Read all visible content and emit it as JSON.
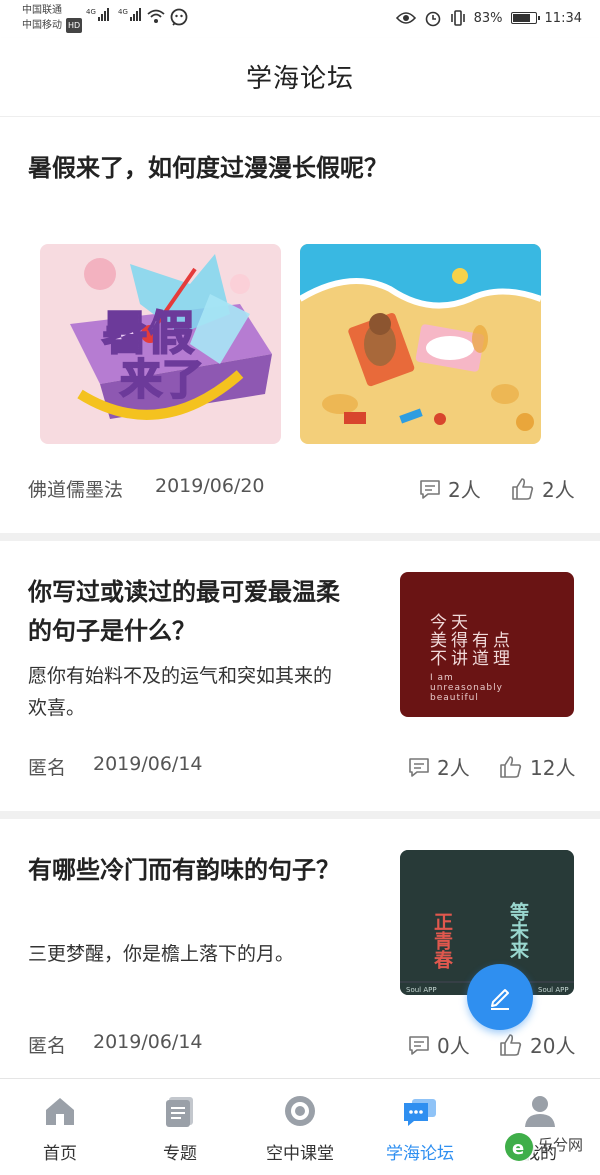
{
  "status_bar": {
    "carrier1": "中国联通",
    "carrier2": "中国移动",
    "hd": "HD",
    "net1": "4G",
    "net2": "4G",
    "battery_percent": "83%",
    "battery_level": 0.83,
    "time": "11:34"
  },
  "header": {
    "title": "学海论坛"
  },
  "posts": [
    {
      "title": "暑假来了，如何度过漫漫长假呢？",
      "image1_text_a": "暑假",
      "image1_text_b": "来了",
      "author": "佛道儒墨法",
      "date": "2019/06/20",
      "comments": "2人",
      "likes": "2人"
    },
    {
      "title_line1": "你写过或读过的最可爱最温柔",
      "title_line2": "的句子是什么？",
      "excerpt_line1": "愿你有始料不及的运气和突如其来的",
      "excerpt_line2": "欢喜。",
      "thumb_line1": "今天",
      "thumb_line2": "美得有点",
      "thumb_line3": "不讲道理",
      "thumb_en1": "I am",
      "thumb_en2": "unreasonably",
      "thumb_en3": "beautiful",
      "author": "匿名",
      "date": "2019/06/14",
      "comments": "2人",
      "likes": "12人"
    },
    {
      "title": "有哪些冷门而有韵味的句子？",
      "excerpt": "三更梦醒，你是檐上落下的月。",
      "thumb_left": "正青春",
      "thumb_right": "等未来",
      "thumb_footer_left": "Soul APP",
      "thumb_footer_right": "Soul APP",
      "author": "匿名",
      "date": "2019/06/14",
      "comments": "0人",
      "likes": "20人"
    }
  ],
  "tabs": [
    {
      "label": "首页",
      "icon": "home-icon"
    },
    {
      "label": "专题",
      "icon": "topics-icon"
    },
    {
      "label": "空中课堂",
      "icon": "disc-icon"
    },
    {
      "label": "学海论坛",
      "icon": "chat-icon"
    },
    {
      "label": "我的",
      "icon": "user-icon"
    }
  ],
  "watermark": "乐兮网",
  "colors": {
    "accent": "#2f8ff0",
    "text": "#222222",
    "muted": "#555555"
  }
}
